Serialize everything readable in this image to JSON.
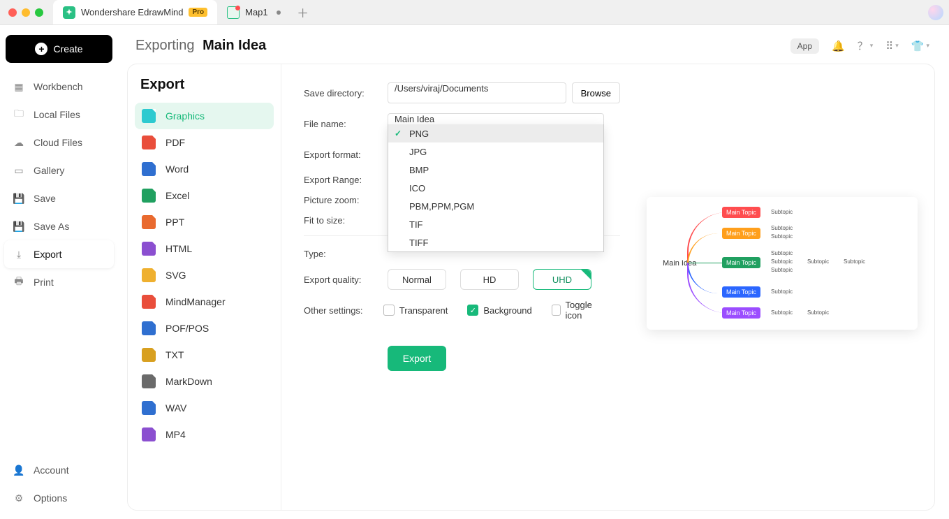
{
  "titlebar": {
    "app_name": "Wondershare EdrawMind",
    "pro_badge": "Pro",
    "doc_tab": "Map1"
  },
  "leftnav": {
    "create": "Create",
    "items": [
      "Workbench",
      "Local Files",
      "Cloud Files",
      "Gallery",
      "Save",
      "Save As",
      "Export",
      "Print"
    ],
    "bottom": [
      "Account",
      "Options"
    ]
  },
  "header": {
    "prefix": "Exporting",
    "title": "Main Idea",
    "app_pill": "App"
  },
  "export_panel": {
    "heading": "Export",
    "types": [
      "Graphics",
      "PDF",
      "Word",
      "Excel",
      "PPT",
      "HTML",
      "SVG",
      "MindManager",
      "POF/POS",
      "TXT",
      "MarkDown",
      "WAV",
      "MP4"
    ]
  },
  "form": {
    "save_dir_label": "Save directory:",
    "save_dir_value": "/Users/viraj/Documents",
    "browse": "Browse",
    "filename_label": "File name:",
    "filename_value": "Main Idea",
    "format_label": "Export format:",
    "format_value": "PNG",
    "format_options": [
      "PNG",
      "JPG",
      "BMP",
      "ICO",
      "PBM,PPM,PGM",
      "TIF",
      "TIFF"
    ],
    "range_label": "Export Range:",
    "zoom_label": "Picture zoom:",
    "fit_label": "Fit to size:",
    "type_label": "Type:",
    "quality_label": "Export quality:",
    "quality_options": [
      "Normal",
      "HD",
      "UHD"
    ],
    "other_label": "Other settings:",
    "transparent": "Transparent",
    "background": "Background",
    "toggleicon": "Toggle icon",
    "export_btn": "Export"
  },
  "preview": {
    "root": "Main Idea",
    "topic": "Main Topic",
    "subtopic": "Subtopic",
    "colors": [
      "#ff4d4f",
      "#ff9f1c",
      "#20a060",
      "#2b66ff",
      "#9b4dff"
    ]
  }
}
